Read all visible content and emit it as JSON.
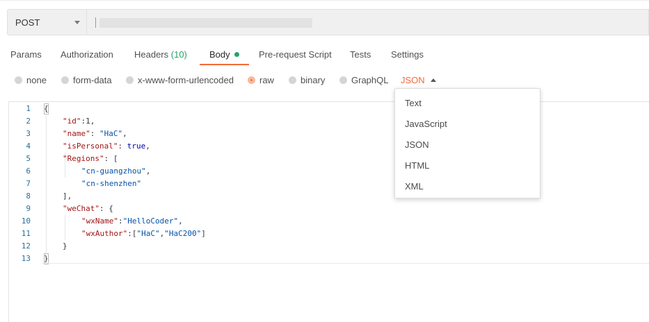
{
  "request": {
    "method": "POST"
  },
  "tabs": [
    {
      "label": "Params"
    },
    {
      "label": "Authorization"
    },
    {
      "label": "Headers",
      "count": "(10)"
    },
    {
      "label": "Body",
      "active": true
    },
    {
      "label": "Pre-request Script"
    },
    {
      "label": "Tests"
    },
    {
      "label": "Settings"
    }
  ],
  "body_types": [
    {
      "label": "none",
      "selected": false
    },
    {
      "label": "form-data",
      "selected": false
    },
    {
      "label": "x-www-form-urlencoded",
      "selected": false
    },
    {
      "label": "raw",
      "selected": true
    },
    {
      "label": "binary",
      "selected": false
    },
    {
      "label": "GraphQL",
      "selected": false
    }
  ],
  "format": {
    "selected": "JSON",
    "options": [
      "Text",
      "JavaScript",
      "JSON",
      "HTML",
      "XML"
    ]
  },
  "editor": {
    "line_numbers": [
      "1",
      "2",
      "3",
      "4",
      "5",
      "6",
      "7",
      "8",
      "9",
      "10",
      "11",
      "12",
      "13"
    ],
    "tokens": {
      "open": "{",
      "id_key": "\"id\"",
      "id_val": ":1,",
      "name_key": "\"name\"",
      "name_sep": ": ",
      "name_val": "\"HaC\"",
      "name_end": ",",
      "personal_key": "\"isPersonal\"",
      "personal_sep": ": ",
      "personal_val": "true",
      "personal_end": ",",
      "regions_key": "\"Regions\"",
      "regions_open": ": [",
      "region1": "\"cn-guangzhou\"",
      "region1_end": ",",
      "region2": "\"cn-shenzhen\"",
      "regions_close": "],",
      "wechat_key": "\"weChat\"",
      "wechat_open": ": {",
      "wxname_key": "\"wxName\"",
      "wxname_sep": ":",
      "wxname_val": "\"HelloCoder\"",
      "wxname_end": ",",
      "wxauthor_key": "\"wxAuthor\"",
      "wxauthor_open": ":[",
      "wxauthor_v1": "\"HaC\"",
      "wxauthor_comma": ",",
      "wxauthor_v2": "\"HaC200\"",
      "wxauthor_close": "]",
      "wechat_close": "}",
      "close": "}"
    }
  },
  "colors": {
    "accent": "#f26b3a",
    "success": "#26a269",
    "json_key": "#a31515",
    "json_string": "#0451a5",
    "json_bool": "#0000aa",
    "line_number": "#2b6e9a"
  }
}
